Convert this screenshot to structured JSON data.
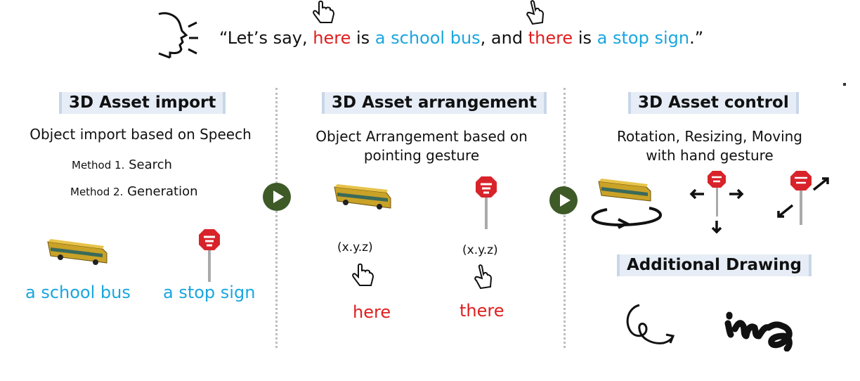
{
  "speech": {
    "open_quote": "“",
    "t1": "Let’s say, ",
    "here": "here",
    "t2": " is ",
    "school_bus": "a school bus",
    "t3": ", and ",
    "there": "there",
    "t4": " is ",
    "stop_sign": "a stop sign",
    "t5": ".”"
  },
  "sections": {
    "import": {
      "title": "3D Asset import",
      "desc": "Object import based on Speech",
      "method1_num": "Method 1.",
      "method1_text": "Search",
      "method2_num": "Method 2.",
      "method2_text": "Generation",
      "label_bus": "a school bus",
      "label_sign": "a stop sign"
    },
    "arrangement": {
      "title": "3D Asset arrangement",
      "desc_line1": "Object Arrangement based on",
      "desc_line2": "pointing gesture",
      "xyz1": "(x.y.z)",
      "xyz2": "(x.y.z)",
      "here": "here",
      "there": "there"
    },
    "control": {
      "title": "3D Asset control",
      "desc_line1": "Rotation, Resizing, Moving",
      "desc_line2": "with hand gesture",
      "drawing_title": "Additional Drawing"
    }
  },
  "colors": {
    "highlight_red": "#e01e1e",
    "highlight_blue": "#1aa6df",
    "arrow_green": "#3d5a27",
    "title_bg": "#e6edf6"
  }
}
